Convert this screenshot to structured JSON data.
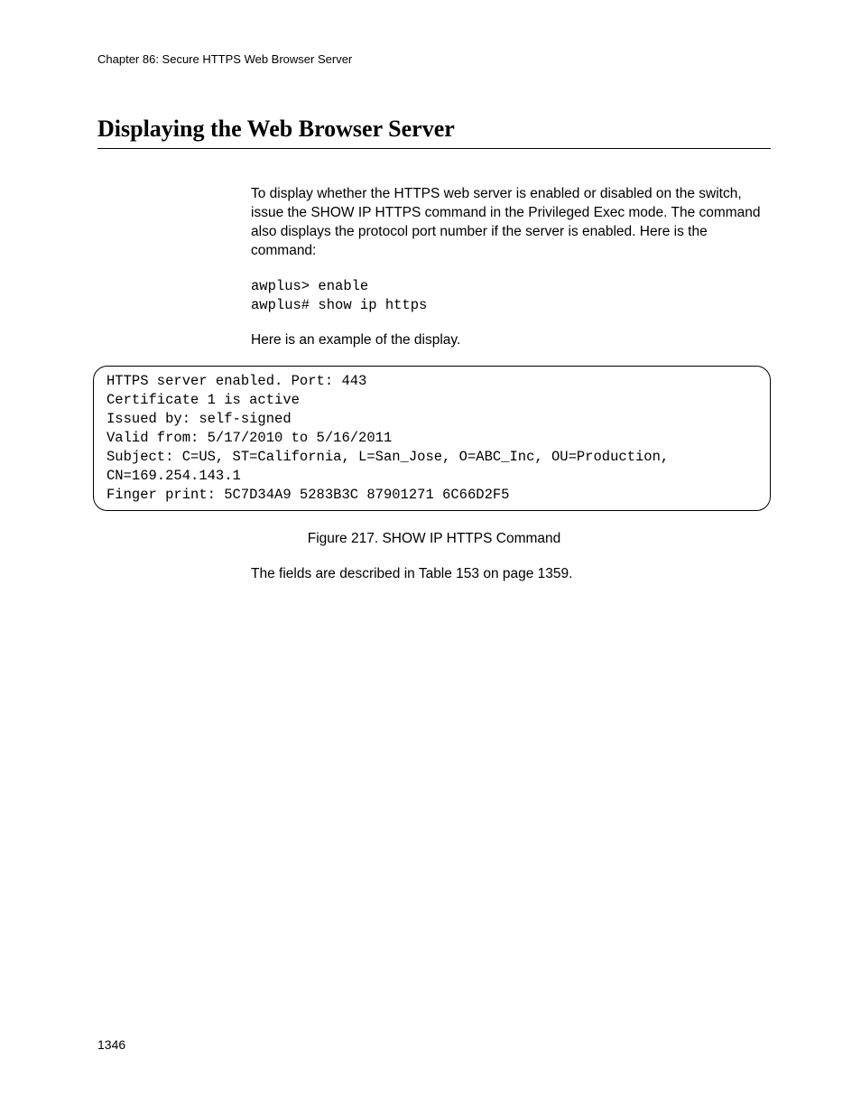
{
  "chapterHeader": "Chapter 86: Secure HTTPS Web Browser Server",
  "sectionTitle": "Displaying the Web Browser Server",
  "introPara": "To display whether the HTTPS web server is enabled or disabled on the switch, issue the SHOW IP HTTPS command in the Privileged Exec mode. The command also displays the protocol port number if the server is enabled. Here is the command:",
  "commandBlock": "awplus> enable\nawplus# show ip https",
  "exampleIntro": "Here is an example of the display.",
  "terminalOutput": "HTTPS server enabled. Port: 443\nCertificate 1 is active\nIssued by: self-signed\nValid from: 5/17/2010 to 5/16/2011\nSubject: C=US, ST=California, L=San_Jose, O=ABC_Inc, OU=Production, CN=169.254.143.1\nFinger print: 5C7D34A9 5283B3C 87901271 6C66D2F5",
  "figureCaption": "Figure 217. SHOW IP HTTPS Command",
  "fieldsPara": "The fields are described in Table 153 on page 1359.",
  "pageNumber": "1346"
}
